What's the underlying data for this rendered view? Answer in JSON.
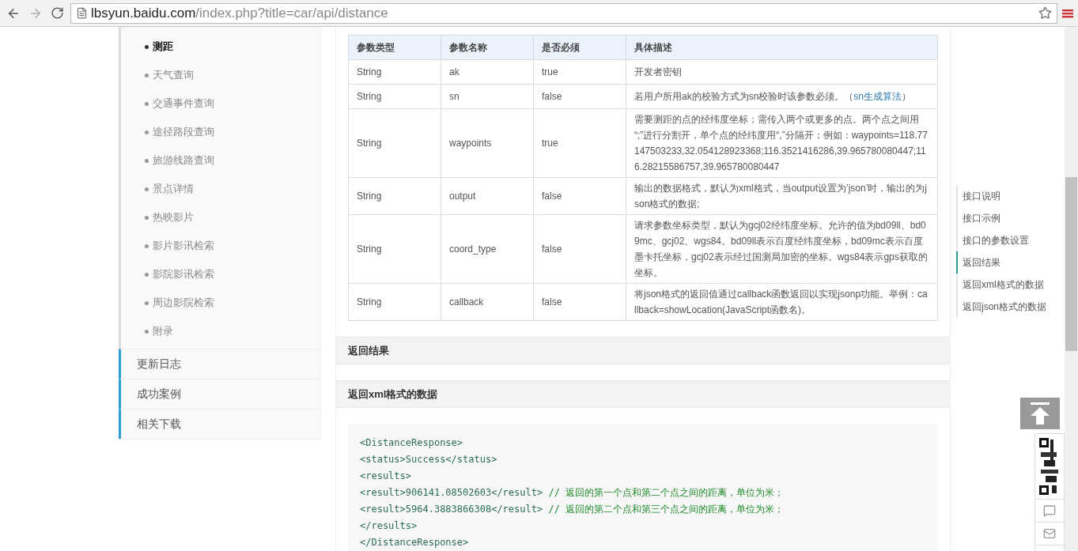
{
  "browser": {
    "url_host": "lbsyun.baidu.com",
    "url_path": "/index.php?title=car/api/distance"
  },
  "sidebar": {
    "sub_items": [
      {
        "label": "测距",
        "selected": true
      },
      {
        "label": "天气查询",
        "selected": false
      },
      {
        "label": "交通事件查询",
        "selected": false
      },
      {
        "label": "途径路段查询",
        "selected": false
      },
      {
        "label": "旅游线路查询",
        "selected": false
      },
      {
        "label": "景点详情",
        "selected": false
      },
      {
        "label": "热映影片",
        "selected": false
      },
      {
        "label": "影片影讯检索",
        "selected": false
      },
      {
        "label": "影院影讯检索",
        "selected": false
      },
      {
        "label": "周边影院检索",
        "selected": false
      },
      {
        "label": "附录",
        "selected": false
      }
    ],
    "items": [
      "更新日志",
      "成功案例",
      "相关下载"
    ]
  },
  "table": {
    "columns": [
      "参数类型",
      "参数名称",
      "是否必须",
      "具体描述"
    ],
    "rows": [
      {
        "type": "String",
        "name": "ak",
        "required": "true",
        "description": "开发者密钥"
      },
      {
        "type": "String",
        "name": "sn",
        "required": "false",
        "description": "若用户所用ak的校验方式为sn校验时该参数必须。（",
        "link": "sn生成算法",
        "description_after": "）"
      },
      {
        "type": "String",
        "name": "waypoints",
        "required": "true",
        "description": "需要测距的点的经纬度坐标；需传入两个或更多的点。两个点之间用 “;”进行分割开，单个点的经纬度用“,”分隔开；例如：waypoints=118.77147503233,32.054128923368;116.3521416286,39.965780080447;116.28215586757,39.965780080447"
      },
      {
        "type": "String",
        "name": "output",
        "required": "false",
        "description": "输出的数据格式，默认为xml格式，当output设置为’json’时，输出的为json格式的数据;"
      },
      {
        "type": "String",
        "name": "coord_type",
        "required": "false",
        "description": "请求参数坐标类型，默认为gcj02经纬度坐标。允许的值为bd09ll、bd09mc、gcj02、wgs84。bd09ll表示百度经纬度坐标，bd09mc表示百度墨卡托坐标，gcj02表示经过国测局加密的坐标。wgs84表示gps获取的坐标。"
      },
      {
        "type": "String",
        "name": "callback",
        "required": "false",
        "description": "将json格式的返回值通过callback函数返回以实现jsonp功能。举例：callback=showLocation(JavaScript函数名)。"
      }
    ]
  },
  "sections": [
    {
      "title": "返回结果"
    },
    {
      "title": "返回xml格式的数据"
    }
  ],
  "code": [
    {
      "code": "<DistanceResponse>"
    },
    {
      "code": "<status>Success</status>"
    },
    {
      "code": "<results>"
    },
    {
      "code": "<result>906141.08502603</result>",
      "comment": "// 返回的第一个点和第二个点之间的距离，单位为米；"
    },
    {
      "code": "<result>5964.3883866308</result>",
      "comment": "// 返回的第二个点和第三个点之间的距离，单位为米；"
    },
    {
      "code": "</results>"
    },
    {
      "code": "</DistanceResponse>"
    }
  ],
  "toc": [
    {
      "label": "接口说明",
      "selected": false
    },
    {
      "label": "接口示例",
      "selected": false
    },
    {
      "label": "接口的参数设置",
      "selected": false
    },
    {
      "label": "返回结果",
      "selected": true
    },
    {
      "label": "返回xml格式的数据",
      "selected": false
    },
    {
      "label": "返回json格式的数据",
      "selected": false
    }
  ]
}
